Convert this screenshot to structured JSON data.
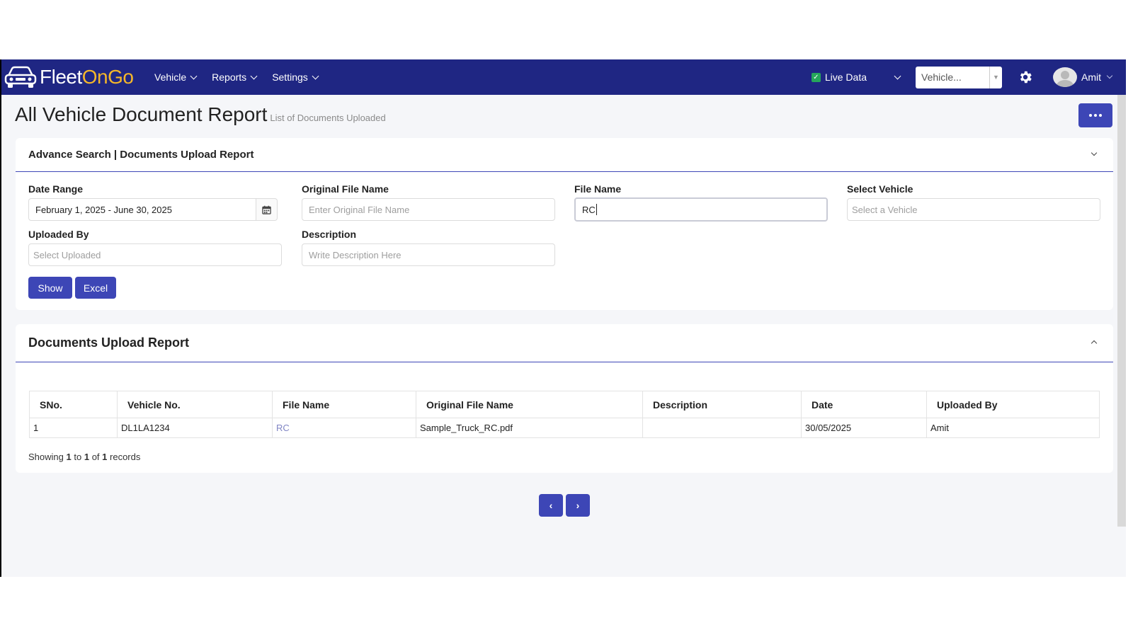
{
  "brand": {
    "name_part1": "Fleet",
    "name_part2": "OnGo",
    "accent_color": "#f5b72a",
    "bar_color": "#1f2683"
  },
  "nav": {
    "items": [
      {
        "label": "Vehicle"
      },
      {
        "label": "Reports"
      },
      {
        "label": "Settings"
      }
    ]
  },
  "header": {
    "live_data_label": "Live Data",
    "live_data_checked": true,
    "vehicle_select_value": "Vehicle...",
    "user_name": "Amit"
  },
  "page": {
    "title": "All Vehicle Document Report",
    "subtitle": "List of Documents Uploaded"
  },
  "search": {
    "card_title": "Advance Search | Documents Upload Report",
    "date_range_label": "Date Range",
    "date_range_value": "February 1, 2025 - June 30, 2025",
    "original_file_name_label": "Original File Name",
    "original_file_name_placeholder": "Enter Original File Name",
    "file_name_label": "File Name",
    "file_name_value": "RC",
    "select_vehicle_label": "Select Vehicle",
    "select_vehicle_placeholder": "Select a Vehicle",
    "uploaded_by_label": "Uploaded By",
    "uploaded_by_placeholder": "Select Uploaded",
    "description_label": "Description",
    "description_placeholder": "Write Description Here",
    "show_button": "Show",
    "excel_button": "Excel"
  },
  "report": {
    "card_title": "Documents Upload Report",
    "columns": [
      "SNo.",
      "Vehicle No.",
      "File Name",
      "Original File Name",
      "Description",
      "Date",
      "Uploaded By"
    ],
    "rows": [
      {
        "sno": "1",
        "vehicle_no": "DL1LA1234",
        "file_name": "RC",
        "original_file_name": "Sample_Truck_RC.pdf",
        "description": "",
        "date": "30/05/2025",
        "uploaded_by": "Amit"
      }
    ],
    "showing_prefix": "Showing",
    "showing_from": "1",
    "showing_to_word": "to",
    "showing_to": "1",
    "showing_of_word": "of",
    "showing_total": "1",
    "showing_suffix": "records"
  },
  "pager": {
    "prev": "‹",
    "next": "›"
  }
}
